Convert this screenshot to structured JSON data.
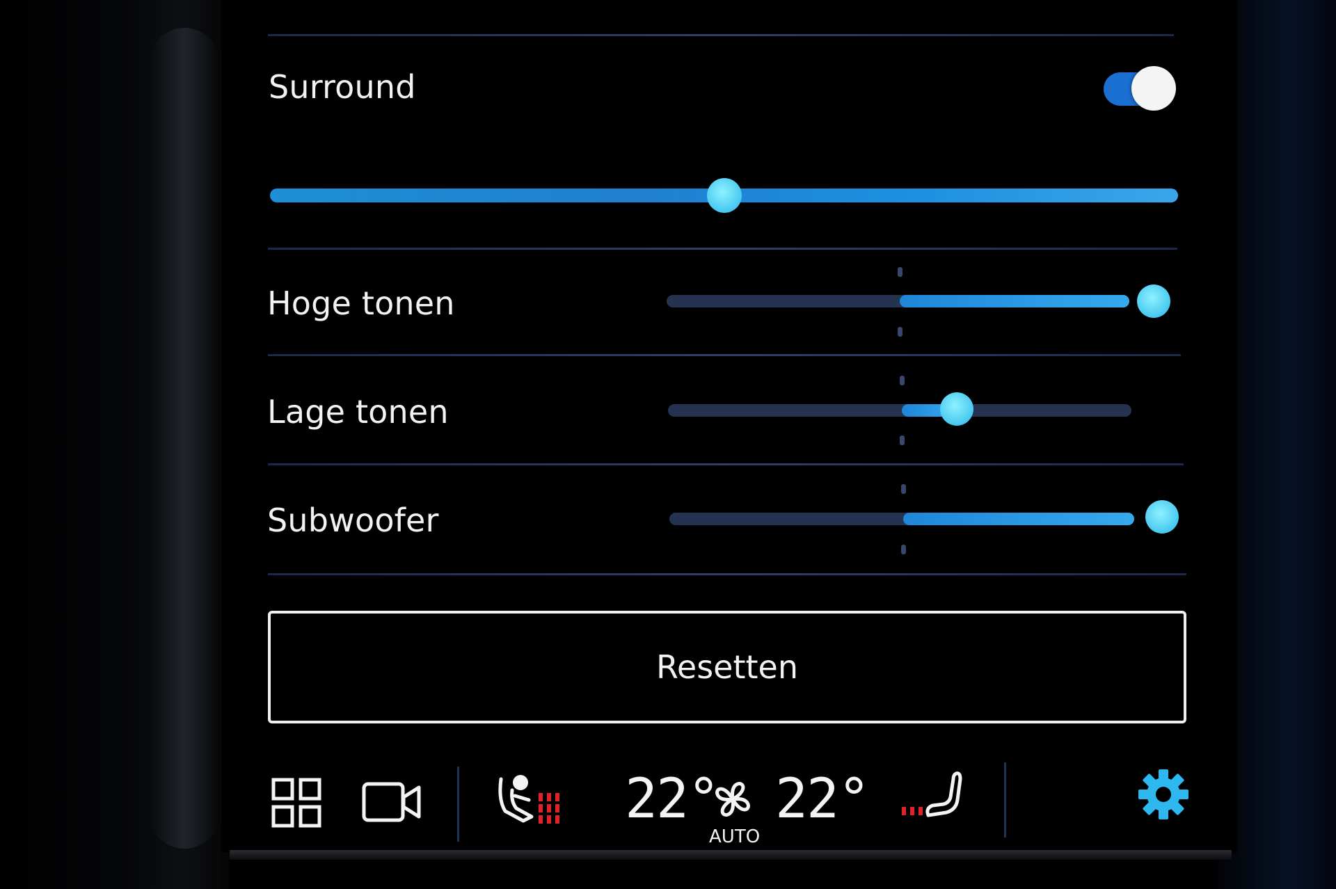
{
  "surround": {
    "label": "Surround",
    "enabled": true,
    "level": 0.5
  },
  "settings": [
    {
      "label": "Hoge tonen",
      "value": 1.0
    },
    {
      "label": "Lage tonen",
      "value": 0.24
    },
    {
      "label": "Subwoofer",
      "value": 1.0
    }
  ],
  "reset_button": {
    "label": "Resetten"
  },
  "climate": {
    "temp_left": "22°",
    "temp_right": "22°",
    "fan_mode": "AUTO"
  },
  "colors": {
    "accent": "#47c8f0",
    "toggle": "#1a6fd0",
    "heat": "#e0222a",
    "settings_icon": "#2fb8f0"
  },
  "icons": {
    "home": "grid-icon",
    "camera": "camera-icon",
    "seat_left": "seat-heating-left-icon",
    "fan": "fan-icon",
    "seat_right": "seat-heating-right-icon",
    "settings": "gear-icon"
  }
}
